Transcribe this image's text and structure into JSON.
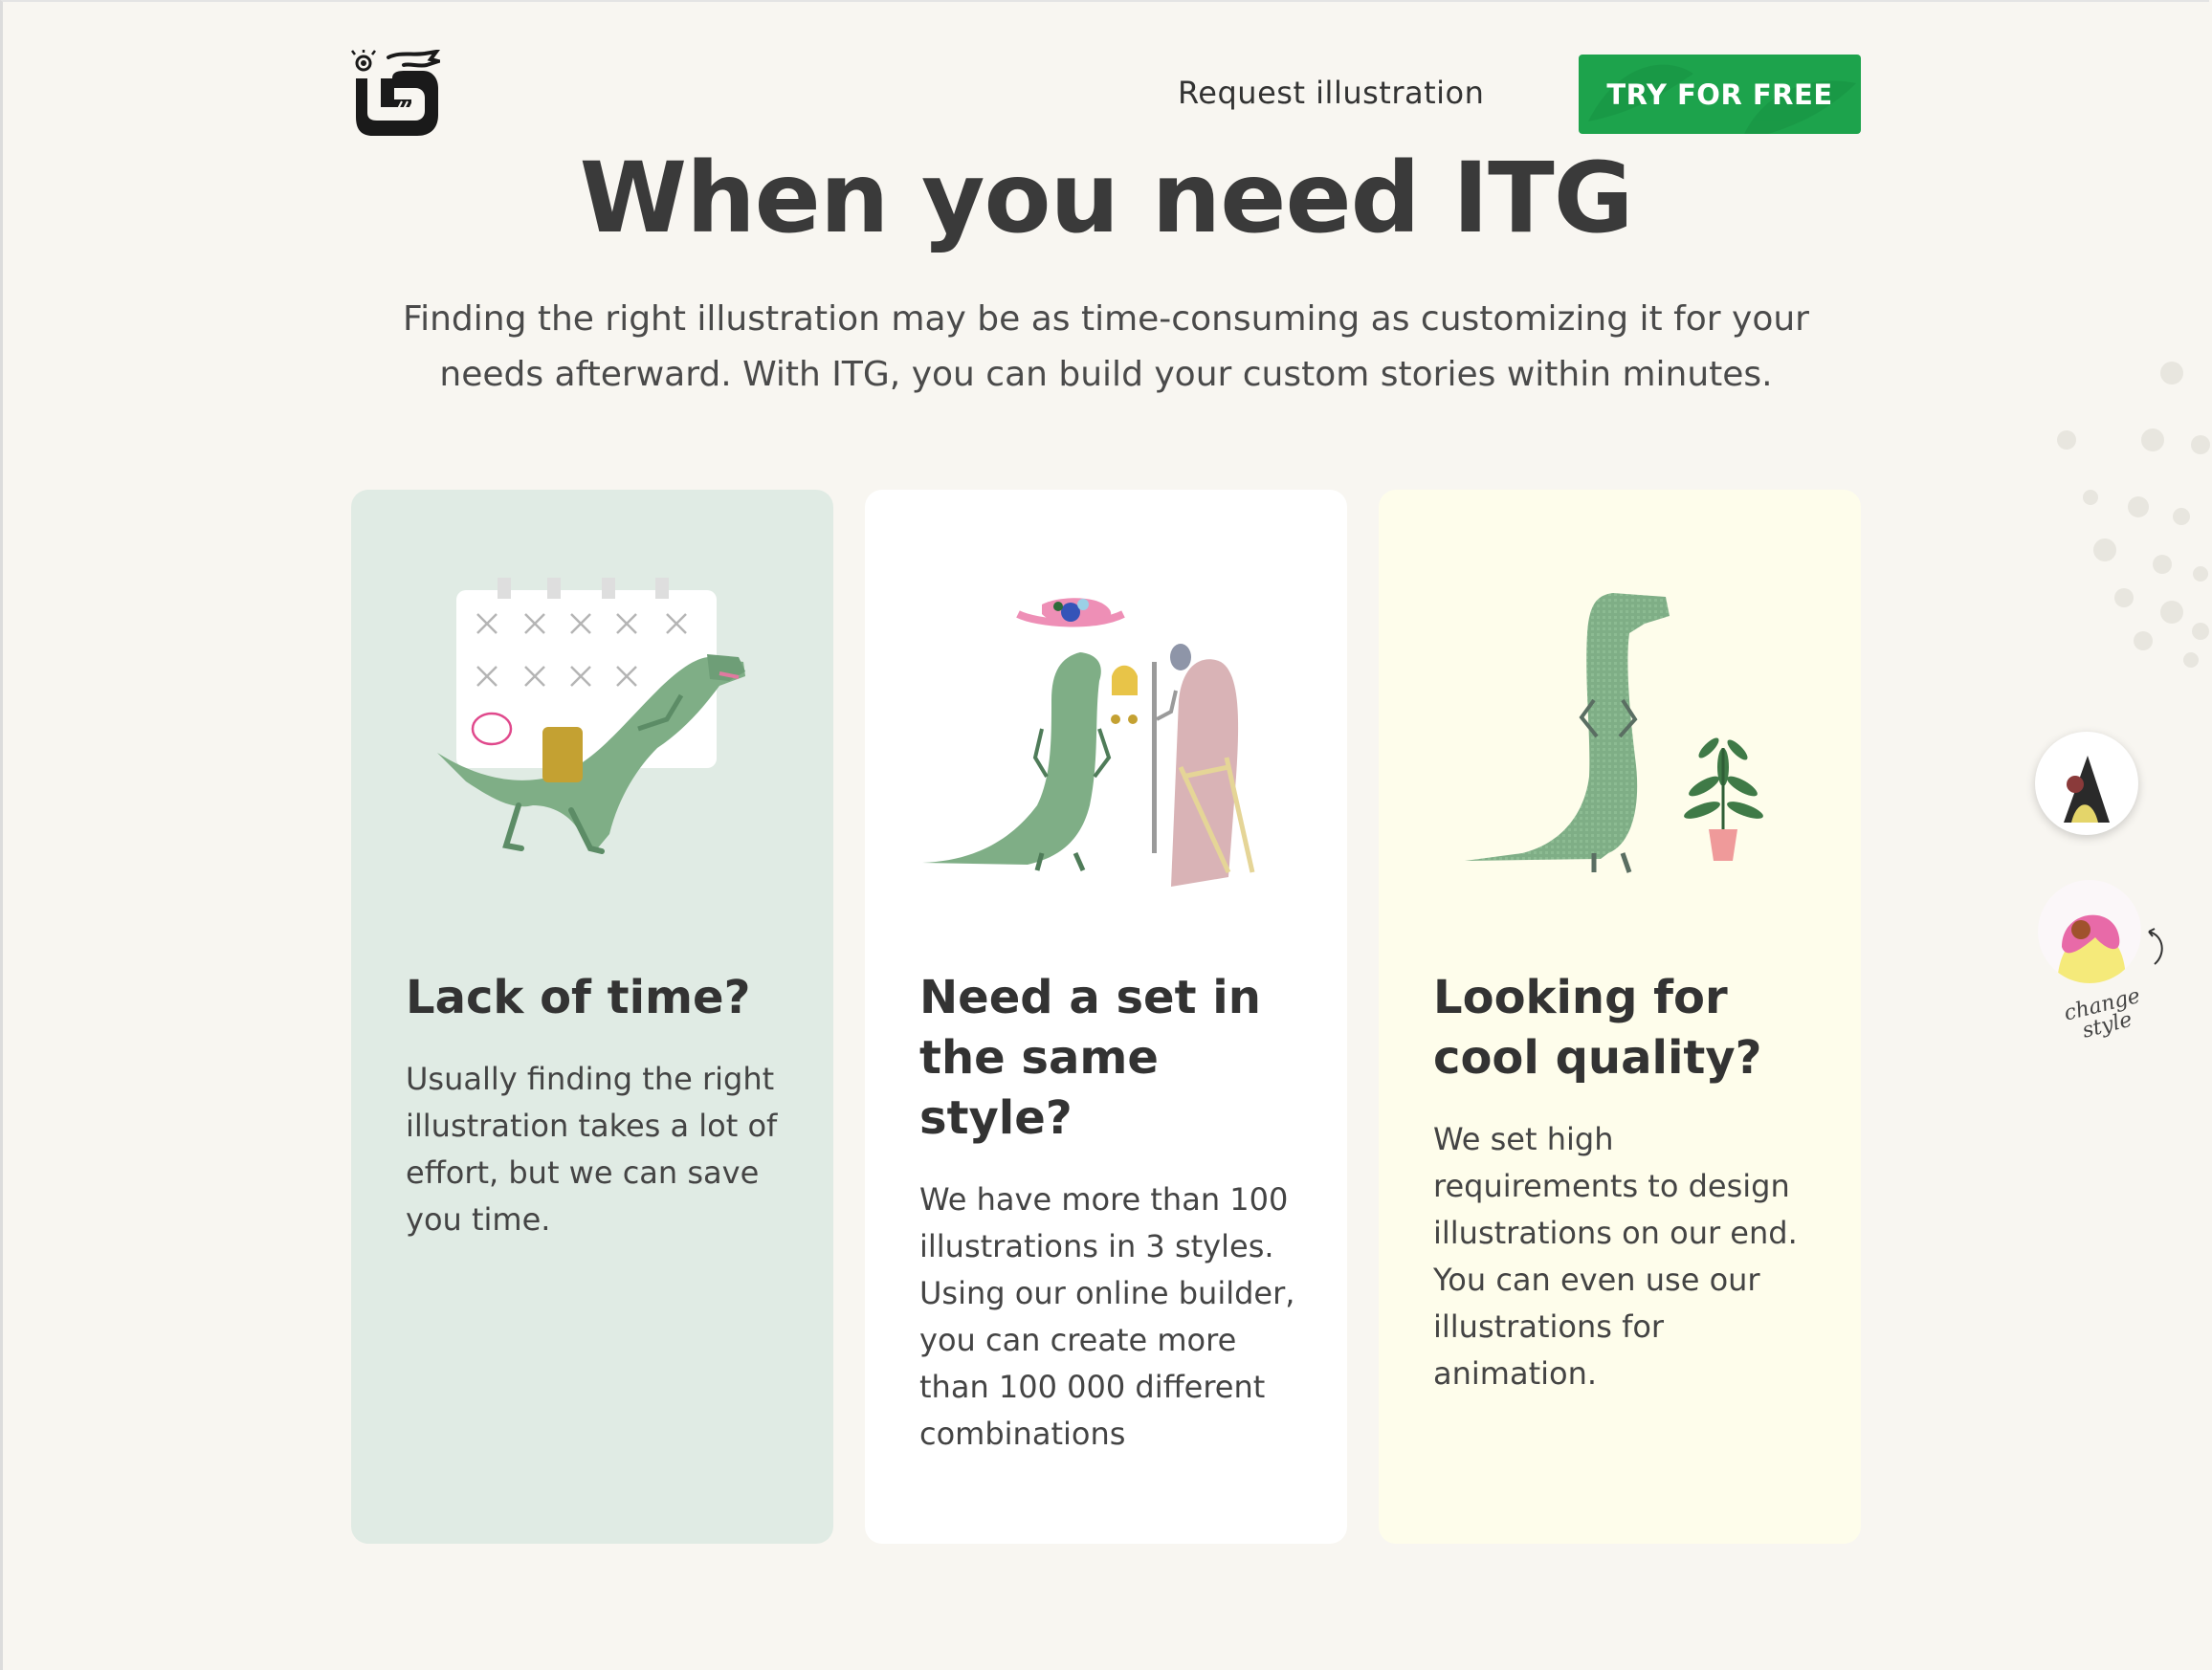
{
  "header": {
    "nav_link": "Request illustration",
    "cta": "TRY FOR FREE"
  },
  "hero": {
    "title": "When you need ITG",
    "lead": "Finding the right illustration may be as time-consuming as customizing it for your needs afterward. With ITG, you can build your custom stories within minutes."
  },
  "cards": [
    {
      "title": "Lack of time?",
      "text": "Usually finding the right illustration takes a lot of effort, but we can save you time.",
      "illustration": "dinosaur-calendar-icon"
    },
    {
      "title": "Need a set in the same style?",
      "text": "We have more than 100 illustrations in 3 styles. Using our online builder, you can create more than 100 000 different combinations",
      "illustration": "dinosaur-hat-mirror-icon"
    },
    {
      "title": "Looking for cool quality?",
      "text": "We set high requirements to design illustrations on our end. You can even use our illustrations for animation.",
      "illustration": "pixel-dinosaur-plant-icon"
    }
  ],
  "side": {
    "change_style_label": "change style"
  },
  "colors": {
    "background": "#f8f6f1",
    "accent_green": "#1da34c",
    "card1_bg": "#e0ebe4",
    "card2_bg": "#ffffff",
    "card3_bg": "#fefdeb",
    "dino_green": "#7fae86"
  }
}
